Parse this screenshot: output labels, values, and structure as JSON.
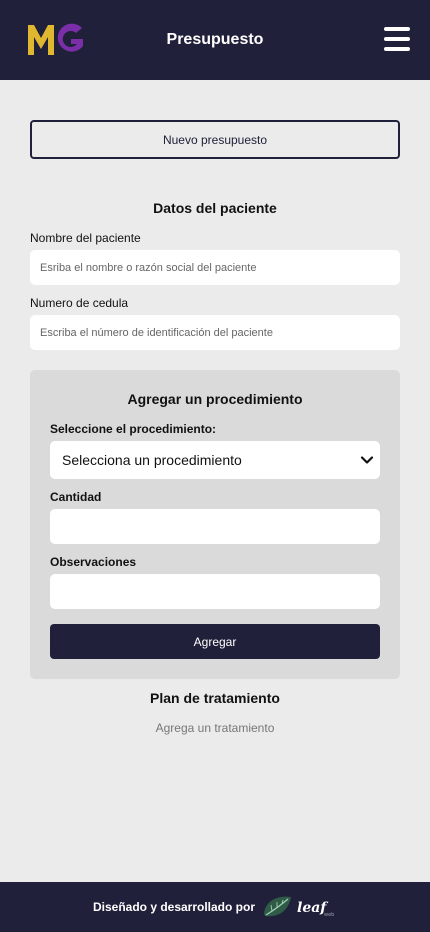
{
  "header": {
    "logo_text": "MG",
    "title": "Presupuesto",
    "menu_icon": "hamburger-menu-icon"
  },
  "new_budget_button": "Nuevo presupuesto",
  "patient": {
    "section_title": "Datos del paciente",
    "name_label": "Nombre del paciente",
    "name_placeholder": "Esriba el nombre o razón social del paciente",
    "id_label": "Numero de cedula",
    "id_placeholder": "Escriba el número de identificación del paciente"
  },
  "procedure": {
    "title": "Agregar un procedimiento",
    "select_label": "Seleccione el procedimiento:",
    "select_value": "Selecciona un procedimiento",
    "quantity_label": "Cantidad",
    "quantity_value": "",
    "notes_label": "Observaciones",
    "notes_value": "",
    "add_button": "Agregar"
  },
  "plan": {
    "title": "Plan de tratamiento",
    "empty_text": "Agrega un tratamiento"
  },
  "footer": {
    "text": "Diseñado y desarrollado por",
    "brand": "leaf",
    "brand_suffix": "web"
  },
  "colors": {
    "primary": "#20203a",
    "background": "#ebebeb",
    "panel": "#dadada",
    "logo_yellow": "#e0b830",
    "logo_purple": "#7a2fa8"
  }
}
